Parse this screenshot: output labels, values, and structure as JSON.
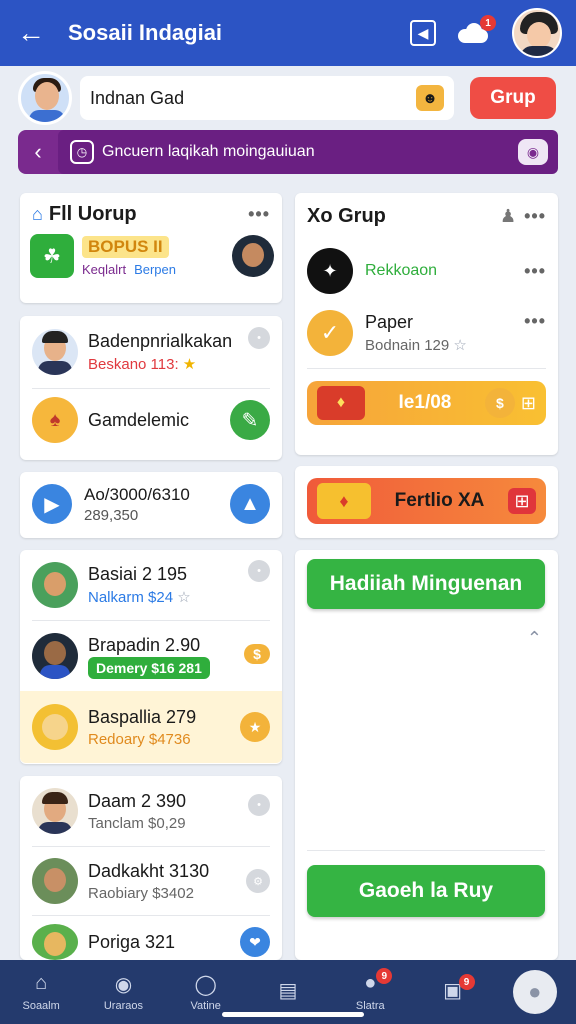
{
  "header": {
    "title": "Sosaii Indagiai",
    "notif_count": "1"
  },
  "search": {
    "value": "Indnan Gad",
    "button": "Grup"
  },
  "banner": {
    "text": "Gncuern laqikah moingauiuan"
  },
  "left": {
    "fl_group": {
      "title": "Fll Uorup",
      "promo_title": "BOPUS II",
      "promo_sub1": "Keqlalrt",
      "promo_sub2": "Berpen"
    },
    "card2": {
      "item1": {
        "name": "Badenpnrialkakan",
        "sub": "Beskano 113:"
      },
      "item2": {
        "name": "Gamdelemic"
      }
    },
    "card3": {
      "name": "Ao/3000/6310",
      "sub": "289,350"
    },
    "list1": [
      {
        "name": "Basiai 2 195",
        "sub": "Nalkarm $24"
      },
      {
        "name": "Brapadin 2.90",
        "sub": "Demery $16 281"
      },
      {
        "name": "Baspallia 279",
        "sub": "Redoary $4736"
      }
    ],
    "list2": [
      {
        "name": "Daam 2 390",
        "sub": "Tanclam $0,29"
      },
      {
        "name": "Dadkakht 3130",
        "sub": "Raobiary $3402"
      },
      {
        "name": "Poriga 321"
      }
    ]
  },
  "right": {
    "group": {
      "title": "Xo Grup",
      "item1": "Rekkoaon",
      "item2_name": "Paper",
      "item2_sub": "Bodnain 129",
      "progress_label": "Ie1/08"
    },
    "feature": {
      "label": "Fertlio XA"
    },
    "btn1": "Hadiiah Minguenan",
    "btn2": "Gaoeh la Ruy"
  },
  "nav": [
    {
      "label": "Soaalm",
      "icon": "home-icon"
    },
    {
      "label": "Uraraos",
      "icon": "people-icon"
    },
    {
      "label": "Vatine",
      "icon": "circle-icon"
    },
    {
      "label": "",
      "icon": "square-icon"
    },
    {
      "label": "Slatra",
      "icon": "bell-icon",
      "badge": "9"
    },
    {
      "label": "",
      "icon": "inbox-icon",
      "badge": "9"
    },
    {
      "label": "",
      "icon": "profile-icon"
    }
  ],
  "colors": {
    "primary": "#2c54c4",
    "banner": "#7a2a8e",
    "accent_red": "#ef4d45",
    "green": "#35b443",
    "nav": "#243a6d"
  }
}
